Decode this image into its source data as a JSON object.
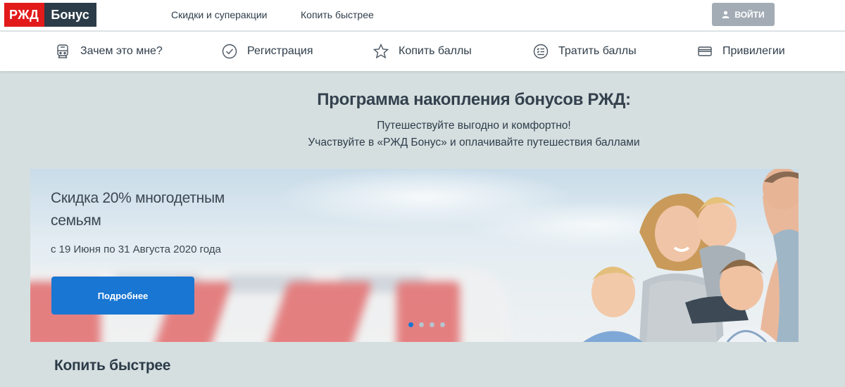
{
  "header": {
    "logo_left": "РЖД",
    "logo_right": "Бонус",
    "links": [
      "Скидки и суперакции",
      "Копить быстрее"
    ],
    "login_label": "ВОЙТИ",
    "login_icon": "user-icon"
  },
  "nav": {
    "items": [
      {
        "label": "Зачем это мне?",
        "icon": "train-icon"
      },
      {
        "label": "Регистрация",
        "icon": "check-circle-icon"
      },
      {
        "label": "Копить баллы",
        "icon": "star-icon"
      },
      {
        "label": "Тратить баллы",
        "icon": "list-circle-icon"
      },
      {
        "label": "Привилегии",
        "icon": "card-icon"
      }
    ]
  },
  "hero": {
    "title": "Программа накопления бонусов РЖД:",
    "subtitle_1": "Путешествуйте выгодно и комфортно!",
    "subtitle_2": "Участвуйте в «РЖД Бонус» и оплачивайте путешествия баллами"
  },
  "banner": {
    "title": "Скидка 20% многодетным семьям",
    "date": "с 19 Июня по 31 Августа 2020 года",
    "button_label": "Подробнее",
    "slides_count": 4,
    "active_slide": 1
  },
  "section": {
    "title": "Копить быстрее"
  },
  "colors": {
    "brand_red": "#e21a1a",
    "brand_dark": "#2c3b48",
    "accent_blue": "#1976d2",
    "page_bg": "#d5dfe0"
  }
}
